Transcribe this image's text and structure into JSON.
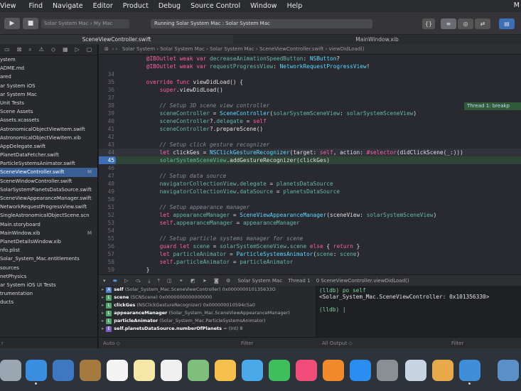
{
  "menubar": {
    "items": [
      "View",
      "Find",
      "Navigate",
      "Editor",
      "Product",
      "Debug",
      "Source Control",
      "Window",
      "Help"
    ],
    "right": "M"
  },
  "toolbar": {
    "run_icon": "play-icon",
    "stop_icon": "stop-icon",
    "scheme": "Solar System Mac  ›  My Mac",
    "status": "Running Solar System Mac : Solar System Mac"
  },
  "tabs": {
    "left": "SceneViewController.swift",
    "right": "MainWindow.xib"
  },
  "jumpbar": [
    "Solar System",
    "Solar System Mac",
    "Solar System Mac",
    "SceneViewController.swift",
    "viewDidLoad()"
  ],
  "files": [
    {
      "name": "ystem"
    },
    {
      "name": "ADME.md"
    },
    {
      "name": "ared"
    },
    {
      "name": "ar System iOS"
    },
    {
      "name": "ar System Mac"
    },
    {
      "name": "Unit Tests"
    },
    {
      "name": "Scene Assets"
    },
    {
      "name": "Assets.xcassets"
    },
    {
      "name": "AstronomicalObjectViewItem.swift"
    },
    {
      "name": "AstronomicalObjectViewItem.xib"
    },
    {
      "name": "AppDelegate.swift"
    },
    {
      "name": "PlanetDataFetcher.swift"
    },
    {
      "name": "ParticleSystemsAnimator.swift"
    },
    {
      "name": "SceneViewController.swift",
      "badge": "M",
      "selected": true
    },
    {
      "name": "SceneWindowController.swift"
    },
    {
      "name": "SolarSystemPlanetsDataSource.swift"
    },
    {
      "name": "SceneViewAppearanceManager.swift"
    },
    {
      "name": "NetworkRequestProgressView.swift"
    },
    {
      "name": "SingleAstronomicalObjectScene.scn"
    },
    {
      "name": "Main.storyboard"
    },
    {
      "name": "MainWindow.xib",
      "badge": "M"
    },
    {
      "name": "PlanetDetailsWindow.xib"
    },
    {
      "name": "nfo.plist"
    },
    {
      "name": "Solar_System_Mac.entitlements"
    },
    {
      "name": "sources"
    },
    {
      "name": "netPhysics"
    },
    {
      "name": "ar System iOS UI Tests"
    },
    {
      "name": "trumentation"
    },
    {
      "name": "ducts"
    }
  ],
  "navfilter": "r",
  "code": [
    {
      "n": "",
      "t": "    @IBOutlet weak var decreaseAnimationSpeedButton: NSButton?"
    },
    {
      "n": "",
      "t": "    @IBOutlet weak var requestProgressView: NetworkRequestProgressView!"
    },
    {
      "n": "34",
      "t": ""
    },
    {
      "n": "35",
      "t": "    override func viewDidLoad() {"
    },
    {
      "n": "36",
      "t": "        super.viewDidLoad()"
    },
    {
      "n": "37",
      "t": ""
    },
    {
      "n": "38",
      "t": "        // Setup 3D scene view controller"
    },
    {
      "n": "39",
      "t": "        sceneController = SceneController(solarSystemSceneView: solarSystemSceneView)"
    },
    {
      "n": "40",
      "t": "        sceneController?.delegate = self"
    },
    {
      "n": "41",
      "t": "        sceneController?.prepareScene()"
    },
    {
      "n": "42",
      "t": ""
    },
    {
      "n": "43",
      "t": "        // Setup click gesture recognizer"
    },
    {
      "n": "44",
      "t": "        let clickGes = NSClickGestureRecognizer(target: self, action: #selector(didClickScene(_:)))"
    },
    {
      "n": "45",
      "t": "        solarSystemSceneView.addGestureRecognizer(clickGes)"
    },
    {
      "n": "46",
      "t": ""
    },
    {
      "n": "47",
      "t": "        // Setup data source"
    },
    {
      "n": "48",
      "t": "        navigatorCollectionView.delegate = planetsDataSource"
    },
    {
      "n": "49",
      "t": "        navigatorCollectionView.dataSource = planetsDataSource"
    },
    {
      "n": "50",
      "t": ""
    },
    {
      "n": "51",
      "t": "        // Setup appearance manager"
    },
    {
      "n": "52",
      "t": "        let appearanceManager = SceneViewAppearanceManager(sceneView: solarSystemSceneView)"
    },
    {
      "n": "53",
      "t": "        self.appearanceManager = appearanceManager"
    },
    {
      "n": "54",
      "t": ""
    },
    {
      "n": "55",
      "t": "        // Setup particle systems manager for scene"
    },
    {
      "n": "56",
      "t": "        guard let scene = solarSystemSceneView.scene else { return }"
    },
    {
      "n": "57",
      "t": "        let particleAnimator = ParticleSystemsAnimator(scene: scene)"
    },
    {
      "n": "58",
      "t": "        self.particleAnimator = particleAnimator"
    },
    {
      "n": "59",
      "t": "    }"
    }
  ],
  "thread_label": "Thread 1: breakp",
  "debugbar": {
    "target": "Solar System Mac",
    "thread": "Thread 1",
    "frame": "0 SceneViewController.viewDidLoad()"
  },
  "vars": [
    {
      "tag": "A",
      "color": "#4f7fd0",
      "name": "self",
      "val": "(Solar_System_Mac.SceneViewController) 0x000000010135633O"
    },
    {
      "tag": "L",
      "color": "#4fa36b",
      "name": "scene",
      "val": "(SCNScene) 0x0000000000000000"
    },
    {
      "tag": "L",
      "color": "#4fa36b",
      "name": "clickGes",
      "val": "(NSClickGestureRecognizer) 0x000000010594c5a0"
    },
    {
      "tag": "L",
      "color": "#4fa36b",
      "name": "appearanceManager",
      "val": "(Solar_System_Mac.SceneViewAppearanceManager)"
    },
    {
      "tag": "L",
      "color": "#4fa36b",
      "name": "particleAnimator",
      "val": "(Solar_System_Mac.ParticleSystemsAnimator)"
    },
    {
      "tag": "E",
      "color": "#7a5fc7",
      "name": "self.planetsDataSource.numberOfPlanets",
      "val": "= (Int) 8"
    }
  ],
  "console": [
    "(lldb) po self",
    "<Solar_System_Mac.SceneViewController: 0x101356330>",
    "",
    "(lldb) |"
  ],
  "bottom": {
    "auto": "Auto ◇",
    "filter1": "Filter",
    "allout": "All Output ◇",
    "filter2": "Filter"
  }
}
